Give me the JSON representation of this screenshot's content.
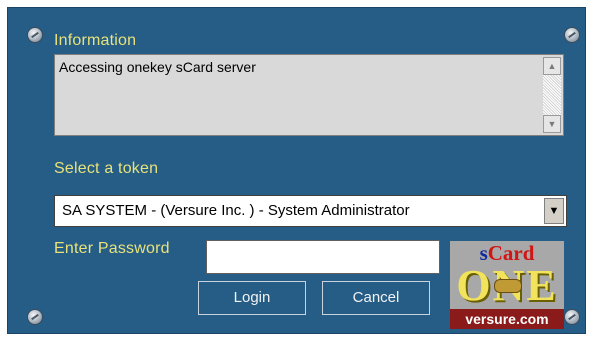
{
  "information": {
    "label": "Information",
    "text": "Accessing onekey sCard server"
  },
  "token": {
    "label": "Select a token",
    "selected": "SA SYSTEM -  (Versure Inc. ) - System Administrator"
  },
  "password": {
    "label": "Enter Password",
    "value": ""
  },
  "buttons": {
    "login": "Login",
    "cancel": "Cancel"
  },
  "logo": {
    "s": "s",
    "card": "Card",
    "one": "ONE",
    "site": "versure.com"
  },
  "colors": {
    "panel": "#255d86",
    "label": "#e8e27a"
  }
}
